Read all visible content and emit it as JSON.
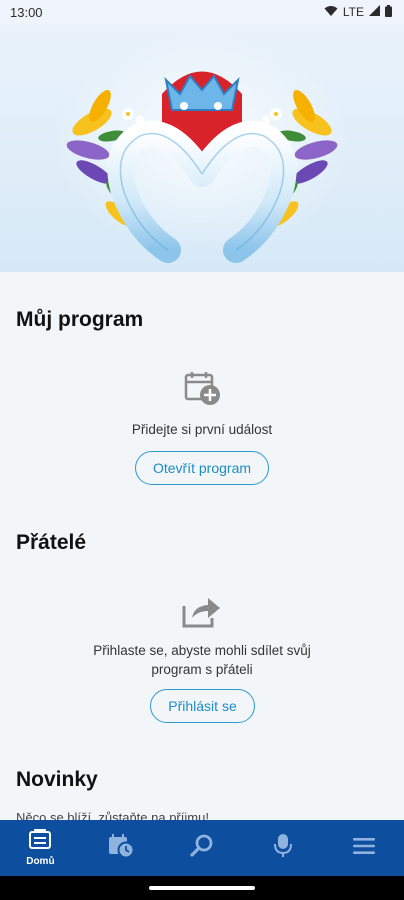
{
  "status_bar": {
    "time": "13:00",
    "network": "LTE",
    "icons": [
      "wifi-icon",
      "signal-icon",
      "battery-icon"
    ]
  },
  "hero": {
    "logo_icon": "festival-logo-heart-crown"
  },
  "my_program": {
    "title": "Můj program",
    "icon": "calendar-add-icon",
    "empty_text": "Přidejte si první událost",
    "button_label": "Otevřít program"
  },
  "friends": {
    "title": "Přátelé",
    "icon": "share-icon",
    "empty_text_line1": "Přihlaste se, abyste mohli sdílet svůj",
    "empty_text_line2": "program s přáteli",
    "button_label": "Přihlásit se"
  },
  "news": {
    "title": "Novinky",
    "teaser": "Něco se blíží, zůstaňte na příjmu!"
  },
  "bottom_nav": {
    "items": [
      {
        "label": "Domů",
        "icon": "home-list-icon",
        "active": true
      },
      {
        "label": "",
        "icon": "calendar-clock-icon",
        "active": false
      },
      {
        "label": "",
        "icon": "search-icon",
        "active": false
      },
      {
        "label": "",
        "icon": "microphone-icon",
        "active": false
      },
      {
        "label": "",
        "icon": "menu-icon",
        "active": false
      }
    ]
  },
  "colors": {
    "accent": "#2a9bd3",
    "nav_background": "#0d4f9e",
    "page_background": "#f3f6f8"
  }
}
